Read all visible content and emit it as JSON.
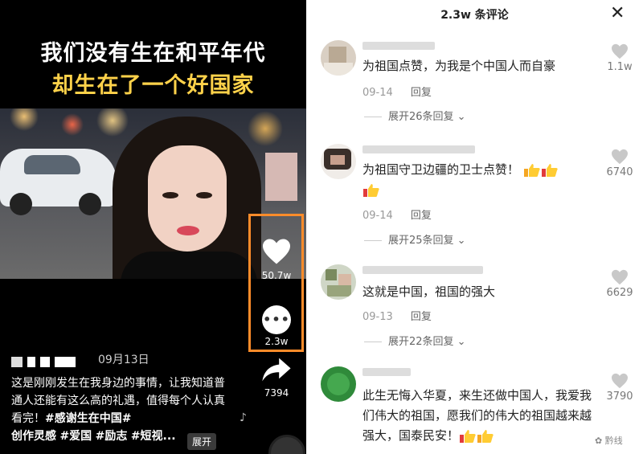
{
  "video": {
    "headline_line1": "我们没有生在和平年代",
    "headline_line2": "却生在了一个好国家",
    "likes_count": "50.7w",
    "comments_count": "2.3w",
    "shares_count": "7394",
    "date": "09月13日",
    "description_plain": "这是刚刚发生在我身边的事情，让我知道普通人还能有这么高的礼遇，值得每个人认真看完！",
    "hashtag_1": "#感谢生在中国#",
    "hashtag_2": "创作灵感",
    "hashtag_3": "#爱国",
    "hashtag_4": "#励志",
    "hashtag_5": "#短视...",
    "expand_label": "展开",
    "accent_color": "#ff8c2a"
  },
  "comments_panel": {
    "title": "2.3w 条评论",
    "close_icon": "close-icon",
    "comments": [
      {
        "text": "为祖国点赞，为我是个中国人而自豪",
        "date": "09-14",
        "reply_label": "回复",
        "expand_replies": "展开26条回复",
        "likes": "1.1w"
      },
      {
        "text": "为祖国守卫边疆的卫士点赞！",
        "date": "09-14",
        "reply_label": "回复",
        "expand_replies": "展开25条回复",
        "likes": "6740"
      },
      {
        "text": "这就是中国，祖国的强大",
        "date": "09-13",
        "reply_label": "回复",
        "expand_replies": "展开22条回复",
        "likes": "6629"
      },
      {
        "text": "此生无悔入华夏，来生还做中国人，我爱我们伟大的祖国，愿我们的伟大的祖国越来越强大，国泰民安！",
        "likes": "3790"
      }
    ]
  },
  "watermark": "黔线"
}
